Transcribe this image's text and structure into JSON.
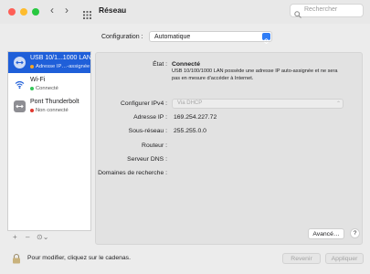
{
  "window": {
    "title": "Réseau",
    "search_placeholder": "Rechercher"
  },
  "configuration": {
    "label": "Configuration :",
    "value": "Automatique"
  },
  "sidebar": {
    "items": [
      {
        "name": "USB 10/1...1000 LAN",
        "status": "Adresse IP…-assignée",
        "status_color": "#f5a623",
        "icon": "ethernet-icon",
        "selected": true
      },
      {
        "name": "Wi-Fi",
        "status": "Connecté",
        "status_color": "#34c759",
        "icon": "wifi-icon",
        "selected": false
      },
      {
        "name": "Pont Thunderbolt",
        "status": "Non connecté",
        "status_color": "#e0392f",
        "icon": "thunderbolt-bridge-icon",
        "selected": false
      }
    ],
    "tools": {
      "add": "+",
      "remove": "–",
      "action": "⊙⌄"
    }
  },
  "detail": {
    "status_label": "État :",
    "status_value": "Connecté",
    "status_desc": "USB 10/100/1000 LAN possède une adresse IP auto-assignée et ne sera pas en mesure d'accéder à Internet.",
    "ipv4_label": "Configurer IPv4 :",
    "ipv4_value": "Via DHCP",
    "ip_label": "Adresse IP :",
    "ip_value": "169.254.227.72",
    "subnet_label": "Sous-réseau :",
    "subnet_value": "255.255.0.0",
    "router_label": "Routeur :",
    "dns_label": "Serveur DNS :",
    "domains_label": "Domaines de recherche :",
    "advanced_label": "Avancé…",
    "help_label": "?"
  },
  "footer": {
    "lock_text": "Pour modifier, cliquez sur le cadenas.",
    "revert_label": "Revenir",
    "apply_label": "Appliquer"
  },
  "colors": {
    "accent": "#1f5fd9",
    "close": "#fe5f57",
    "minimize": "#febc2e",
    "zoom": "#28c840"
  }
}
